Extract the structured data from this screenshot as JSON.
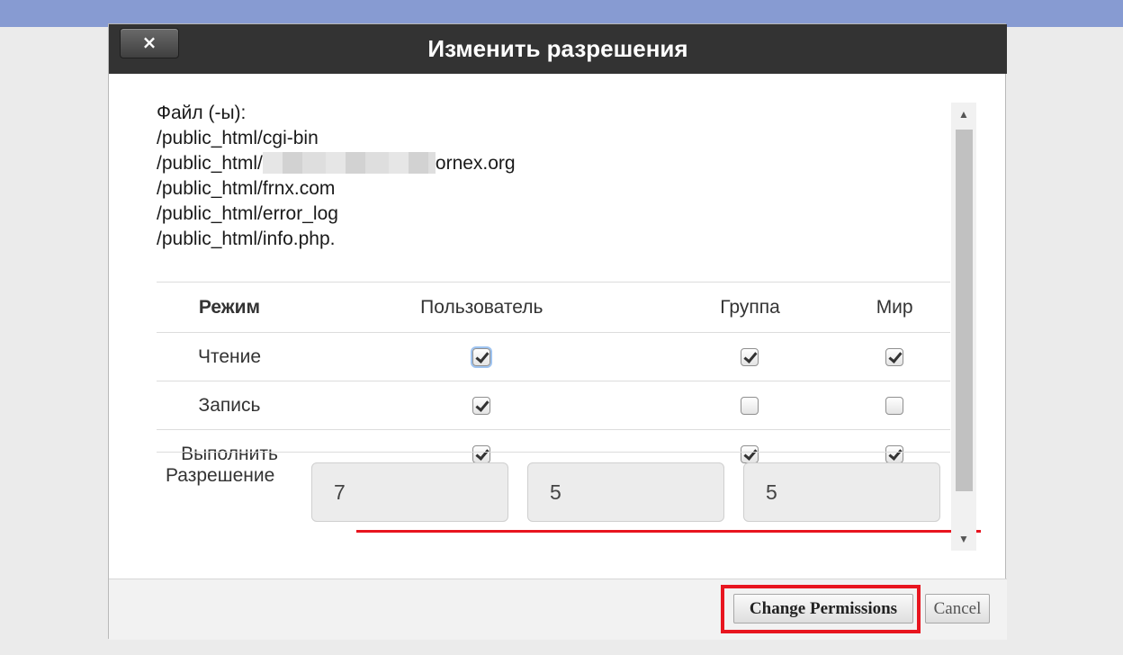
{
  "dialog": {
    "title": "Изменить разрешения",
    "close_label": "×",
    "files_label": "Файл (-ы):",
    "files": [
      {
        "prefix": "/public_html/cgi-bin",
        "suffix": ""
      },
      {
        "prefix": "/public_html/",
        "suffix": "ornex.org"
      },
      {
        "prefix": "/public_html/frnx.com",
        "suffix": ""
      },
      {
        "prefix": "/public_html/error_log",
        "suffix": ""
      },
      {
        "prefix": "/public_html/info.php.",
        "suffix": ""
      }
    ]
  },
  "table": {
    "headers": {
      "mode": "Режим",
      "user": "Пользователь",
      "group": "Группа",
      "world": "Мир"
    },
    "rows": [
      {
        "label": "Чтение",
        "user": true,
        "group": true,
        "world": true
      },
      {
        "label": "Запись",
        "user": true,
        "group": false,
        "world": false
      },
      {
        "label": "Выполнить",
        "user": true,
        "group": true,
        "world": true
      }
    ]
  },
  "permission": {
    "label": "Разрешение",
    "user": "7",
    "group": "5",
    "world": "5"
  },
  "scrollbar": {
    "up_icon": "▲",
    "down_icon": "▼"
  },
  "footer": {
    "change_label": "Change Permissions",
    "cancel_label": "Cancel"
  },
  "colors": {
    "top_bar": "#879bd2",
    "title_bar": "#333333",
    "highlight_red": "#e8151f"
  }
}
